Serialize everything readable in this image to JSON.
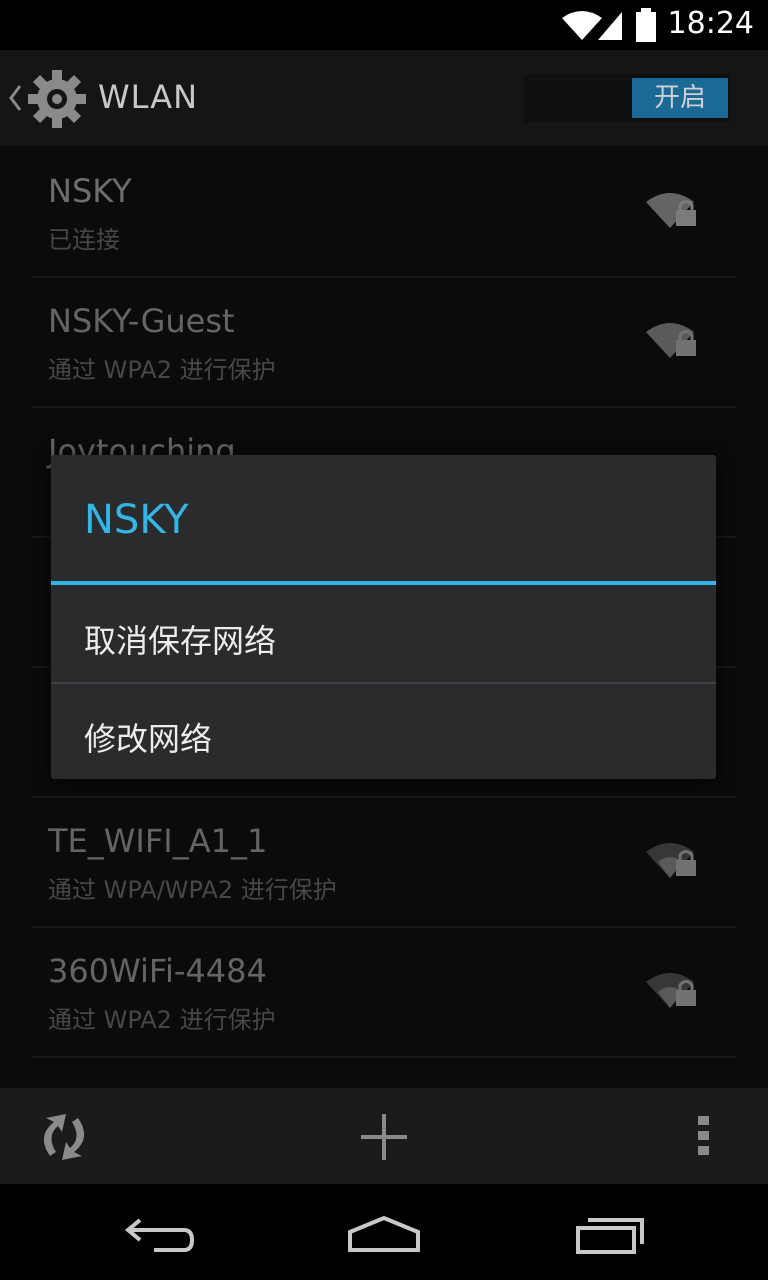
{
  "status_bar": {
    "time": "18:24"
  },
  "app_bar": {
    "title": "WLAN",
    "toggle_label": "开启"
  },
  "networks": [
    {
      "ssid": "NSKY",
      "status": "已连接"
    },
    {
      "ssid": "NSKY-Guest",
      "status": "通过 WPA2 进行保护"
    },
    {
      "ssid": "Joytouching",
      "status": ""
    },
    {
      "ssid": "",
      "status": ""
    },
    {
      "ssid": "",
      "status": ""
    },
    {
      "ssid": "TE_WIFI_A1_1",
      "status": "通过 WPA/WPA2 进行保护"
    },
    {
      "ssid": "360WiFi-4484",
      "status": "通过 WPA2 进行保护"
    }
  ],
  "dialog": {
    "title": "NSKY",
    "items": [
      "取消保存网络",
      "修改网络"
    ]
  },
  "colors": {
    "accent": "#35b5e5",
    "toggle_on": "#1b6a96"
  },
  "icons": [
    "wifi-signal-icon",
    "cell-signal-icon",
    "battery-icon",
    "settings-gear-icon",
    "wifi-lock-icon",
    "wps-icon",
    "add-icon",
    "overflow-menu-icon",
    "back-icon",
    "home-icon",
    "recents-icon"
  ]
}
